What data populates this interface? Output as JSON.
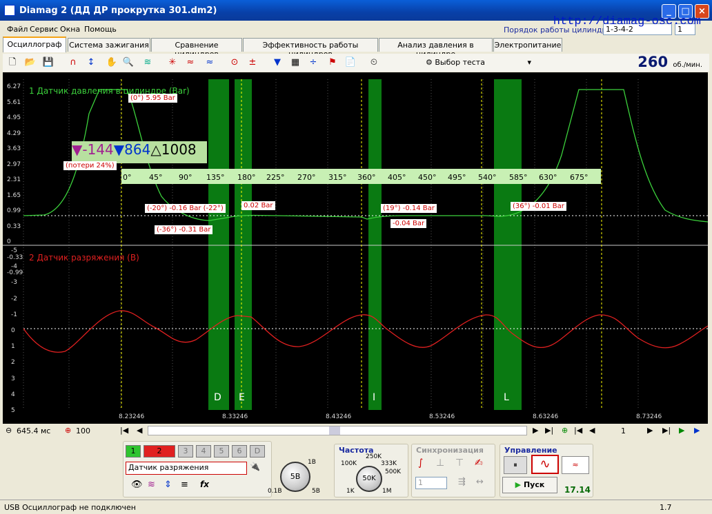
{
  "window": {
    "title": "Diamag 2 (ДД ДР прокрутка 301.dm2)"
  },
  "menu": [
    "Файл",
    "Сервис",
    "Окна",
    "Помощь"
  ],
  "site_url": "http://diamag-osc.com",
  "cylinder_order": {
    "label": "Порядок работы цилиндров",
    "value": "1-3-4-2",
    "second": "1"
  },
  "tabs": [
    "Осциллограф",
    "Система зажигания",
    "Сравнение цилиндров",
    "Эффективность работы цилиндров",
    "Анализ давления в цилиндре",
    "Электропитание"
  ],
  "toolbar": {
    "test_select": "Выбор теста",
    "rpm": "260",
    "rpm_unit": "об./мин."
  },
  "scope": {
    "ch1_label": "1 Датчик давления в цилиндре (Bar)",
    "ch2_label": "2 Датчик разряжения (В)",
    "ch1_ticks": [
      "6.27",
      "5.61",
      "4.95",
      "4.29",
      "3.63",
      "2.97",
      "2.31",
      "1.65",
      "0.99",
      "0.33",
      "0",
      "-0.33",
      "-0.99"
    ],
    "ch2_ticks": [
      "-5",
      "-4",
      "-3",
      "-2",
      "-1",
      "0",
      "1",
      "2",
      "3",
      "4",
      "5"
    ],
    "time_ticks": [
      "8.23246",
      "8.33246",
      "8.43246",
      "8.53246",
      "8.63246",
      "8.73246"
    ],
    "degree_ruler": [
      "0°",
      "45°",
      "90°",
      "135°",
      "180°",
      "225°",
      "270°",
      "315°",
      "360°",
      "405°",
      "450°",
      "495°",
      "540°",
      "585°",
      "630°",
      "675°"
    ],
    "cursor_box": {
      "a": "-144",
      "b": "864",
      "d": "1008"
    },
    "annotations": [
      "(0°) 5.95 Bar",
      "(потери 24%)",
      "(-20°) -0.16 Bar (-22°)",
      "0.02 Bar",
      "(-36°) -0.31 Bar",
      "(19°) -0.14 Bar",
      "-0.04 Bar",
      "(36°) -0.01 Bar"
    ],
    "markers": [
      "D",
      "E",
      "I",
      "L"
    ]
  },
  "bottom": {
    "time_scale": "645.4 мс",
    "amplitude": "100",
    "page": "1",
    "channels": [
      "1",
      "2",
      "3",
      "4",
      "5",
      "6",
      "D"
    ],
    "sensor": "Датчик разряжения",
    "knob_value": "5В",
    "knob_min": "0.1В",
    "knob_max": "5В",
    "knob_top": "1В",
    "freq_title": "Частота",
    "freq_value": "50K",
    "freq_labels": [
      "100K",
      "250K",
      "333K",
      "500K",
      "1K",
      "1M"
    ],
    "sync_title": "Синхронизация",
    "sync_value": "1",
    "control_title": "Управление",
    "start_label": "Пуск",
    "counter": "17.14"
  },
  "status": {
    "left": "USB Осциллограф не подключен",
    "right": "1.7"
  }
}
